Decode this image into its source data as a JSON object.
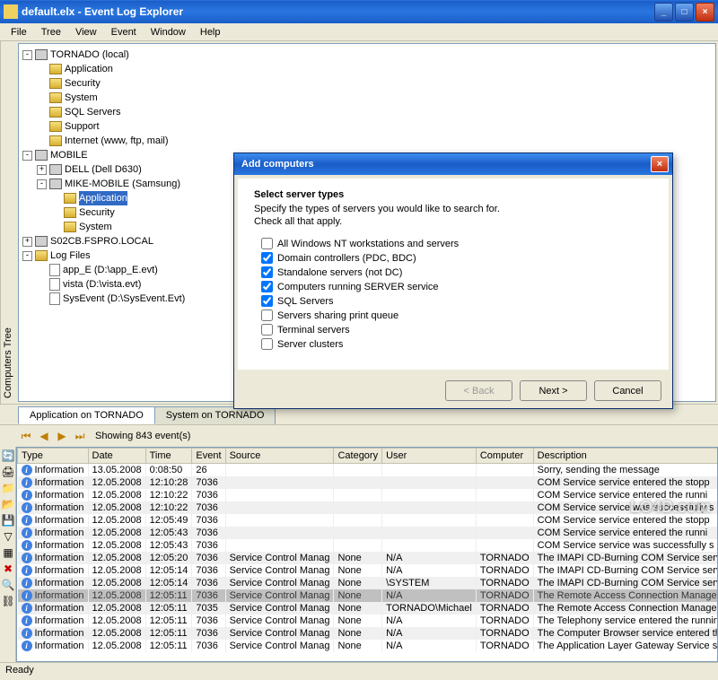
{
  "window": {
    "title": "default.elx - Event Log Explorer",
    "min_label": "_",
    "max_label": "□",
    "close_label": "×"
  },
  "menu": [
    "File",
    "Tree",
    "View",
    "Event",
    "Window",
    "Help"
  ],
  "sidebar_label": "Computers Tree",
  "tree": [
    {
      "lvl": 0,
      "toggle": "-",
      "icon": "comp",
      "label": "TORNADO (local)"
    },
    {
      "lvl": 1,
      "icon": "folder",
      "label": "Application"
    },
    {
      "lvl": 1,
      "icon": "folder",
      "label": "Security"
    },
    {
      "lvl": 1,
      "icon": "folder",
      "label": "System"
    },
    {
      "lvl": 1,
      "icon": "folder",
      "label": "SQL Servers"
    },
    {
      "lvl": 1,
      "icon": "folder",
      "label": "Support"
    },
    {
      "lvl": 1,
      "icon": "folder",
      "label": "Internet (www, ftp, mail)"
    },
    {
      "lvl": 0,
      "toggle": "-",
      "icon": "comp",
      "label": "MOBILE"
    },
    {
      "lvl": 1,
      "toggle": "+",
      "icon": "comp",
      "label": "DELL (Dell D630)"
    },
    {
      "lvl": 1,
      "toggle": "-",
      "icon": "comp",
      "label": "MIKE-MOBILE (Samsung)"
    },
    {
      "lvl": 2,
      "icon": "folder",
      "label": "Application",
      "selected": true
    },
    {
      "lvl": 2,
      "icon": "folder",
      "label": "Security"
    },
    {
      "lvl": 2,
      "icon": "folder",
      "label": "System"
    },
    {
      "lvl": 0,
      "toggle": "+",
      "icon": "comp",
      "label": "S02CB.FSPRO.LOCAL"
    },
    {
      "lvl": 0,
      "toggle": "-",
      "icon": "folder",
      "label": "Log Files"
    },
    {
      "lvl": 1,
      "icon": "file",
      "label": "app_E (D:\\app_E.evt)"
    },
    {
      "lvl": 1,
      "icon": "file",
      "label": "vista (D:\\vista.evt)"
    },
    {
      "lvl": 1,
      "icon": "file",
      "label": "SysEvent (D:\\SysEvent.Evt)"
    }
  ],
  "tabs": [
    {
      "label": "Application on TORNADO",
      "active": true
    },
    {
      "label": "System on TORNADO",
      "active": false
    }
  ],
  "nav_info": "Showing 843 event(s)",
  "grid": {
    "columns": [
      "Type",
      "Date",
      "Time",
      "Event",
      "Source",
      "Category",
      "User",
      "Computer",
      "Description"
    ],
    "rows": [
      [
        "Information",
        "13.05.2008",
        "0:08:50",
        "26",
        "",
        "",
        "",
        "",
        "Sorry, sending the message"
      ],
      [
        "Information",
        "12.05.2008",
        "12:10:28",
        "7036",
        "",
        "",
        "",
        "",
        "COM Service service entered the stopp"
      ],
      [
        "Information",
        "12.05.2008",
        "12:10:22",
        "7036",
        "",
        "",
        "",
        "",
        "COM Service service entered the runni"
      ],
      [
        "Information",
        "12.05.2008",
        "12:10:22",
        "7036",
        "",
        "",
        "",
        "",
        "COM Service service was successfully s"
      ],
      [
        "Information",
        "12.05.2008",
        "12:05:49",
        "7036",
        "",
        "",
        "",
        "",
        "COM Service service entered the stopp"
      ],
      [
        "Information",
        "12.05.2008",
        "12:05:43",
        "7036",
        "",
        "",
        "",
        "",
        "COM Service service entered the runni"
      ],
      [
        "Information",
        "12.05.2008",
        "12:05:43",
        "7036",
        "",
        "",
        "",
        "",
        "COM Service service was successfully s"
      ],
      [
        "Information",
        "12.05.2008",
        "12:05:20",
        "7036",
        "Service Control Manag",
        "None",
        "N/A",
        "TORNADO",
        "The IMAPI CD-Burning COM Service service entered the stopp"
      ],
      [
        "Information",
        "12.05.2008",
        "12:05:14",
        "7036",
        "Service Control Manag",
        "None",
        "N/A",
        "TORNADO",
        "The IMAPI CD-Burning COM Service service entered the runni"
      ],
      [
        "Information",
        "12.05.2008",
        "12:05:14",
        "7036",
        "Service Control Manag",
        "None",
        "\\SYSTEM",
        "TORNADO",
        "The IMAPI CD-Burning COM Service service was successfully s"
      ],
      [
        "Information",
        "12.05.2008",
        "12:05:11",
        "7036",
        "Service Control Manag",
        "None",
        "N/A",
        "TORNADO",
        "The Remote Access Connection Manager service entered the"
      ],
      [
        "Information",
        "12.05.2008",
        "12:05:11",
        "7035",
        "Service Control Manag",
        "None",
        "TORNADO\\Michael",
        "TORNADO",
        "The Remote Access Connection Manager service was success"
      ],
      [
        "Information",
        "12.05.2008",
        "12:05:11",
        "7036",
        "Service Control Manag",
        "None",
        "N/A",
        "TORNADO",
        "The Telephony service entered the running state."
      ],
      [
        "Information",
        "12.05.2008",
        "12:05:11",
        "7036",
        "Service Control Manag",
        "None",
        "N/A",
        "TORNADO",
        "The Computer Browser service entered the stopped state."
      ],
      [
        "Information",
        "12.05.2008",
        "12:05:11",
        "7036",
        "Service Control Manag",
        "None",
        "N/A",
        "TORNADO",
        "The Application Layer Gateway Service service entered the r"
      ]
    ],
    "selected_row_index": 10
  },
  "statusbar": "Ready",
  "dialog": {
    "title": "Add computers",
    "heading": "Select server types",
    "sub1": "Specify the types of servers you would like to search for.",
    "sub2": "Check all that apply.",
    "options": [
      {
        "label": "All Windows NT workstations and servers",
        "checked": false
      },
      {
        "label": "Domain controllers (PDC, BDC)",
        "checked": true
      },
      {
        "label": "Standalone servers (not DC)",
        "checked": true
      },
      {
        "label": "Computers running SERVER service",
        "checked": true
      },
      {
        "label": "SQL Servers",
        "checked": true
      },
      {
        "label": "Servers sharing print queue",
        "checked": false
      },
      {
        "label": "Terminal servers",
        "checked": false
      },
      {
        "label": "Server clusters",
        "checked": false
      }
    ],
    "back_label": "< Back",
    "next_label": "Next >",
    "cancel_label": "Cancel"
  },
  "watermark": "LO4D.com"
}
